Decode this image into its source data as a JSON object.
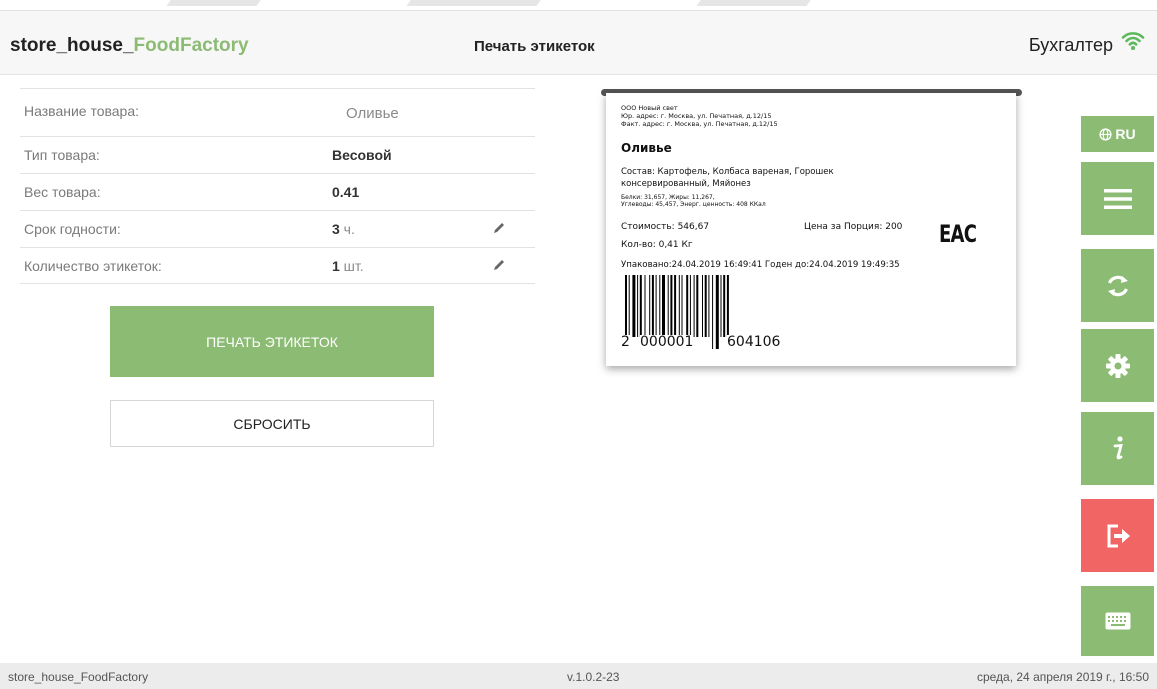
{
  "header": {
    "app_name": "store_house_",
    "app_name_accent": "FoodFactory",
    "title": "Печать этикеток",
    "user": "Бухгалтер",
    "wifi_icon": "wifi-icon"
  },
  "form": {
    "product_name": {
      "label": "Название товара:",
      "value": "Оливье"
    },
    "product_type": {
      "label": "Тип товара:",
      "value": "Весовой"
    },
    "weight": {
      "label": "Вес товара:",
      "value": "0.41"
    },
    "shelf_life": {
      "label": "Срок годности:",
      "value": "3",
      "unit": " ч."
    },
    "label_count": {
      "label": "Количество этикеток:",
      "value": "1",
      "unit": " шт."
    }
  },
  "buttons": {
    "print": "ПЕЧАТЬ ЭТИКЕТОК",
    "reset": "СБРОСИТЬ"
  },
  "label_preview": {
    "company": "ООО Новый свет",
    "legal_address": "Юр. адрес: г. Москва, ул. Печатная, д.12/15",
    "actual_address": "Факт. адрес: г. Москва, ул. Печатная, д.12/15",
    "product": "Оливье",
    "composition": "Состав: Картофель, Колбаса вареная, Горошек консервированный, Мяйонез",
    "nutrition_1": "Белки: 31,657, Жиры: 11,267,",
    "nutrition_2": "Углеводы: 45,457, Энерг. ценность: 408 ККал",
    "cost": "Стоимость: 546,67",
    "price_per_portion": "Цена за Порция: 200",
    "quantity": "Кол-во: 0,41 Кг",
    "packed_expires": "Упаковано:24.04.2019 16:49:41 Годен до:24.04.2019 19:49:35",
    "eac": "EAC",
    "barcode_digits": [
      "2",
      "000001",
      "604106"
    ]
  },
  "sidebar": {
    "language": "RU",
    "globe_icon": "globe-icon",
    "icons": [
      "menu-icon",
      "refresh-icon",
      "gear-icon",
      "info-icon",
      "logout-icon",
      "keyboard-icon"
    ]
  },
  "footer": {
    "app": "store_house_FoodFactory",
    "version": "v.1.0.2-23",
    "date": "среда, 24 апреля 2019 г., 16:50"
  },
  "colors": {
    "accent": "#8cbb74",
    "danger": "#f26565",
    "header_bg": "#f7f7f7",
    "footer_bg": "#ececec"
  }
}
